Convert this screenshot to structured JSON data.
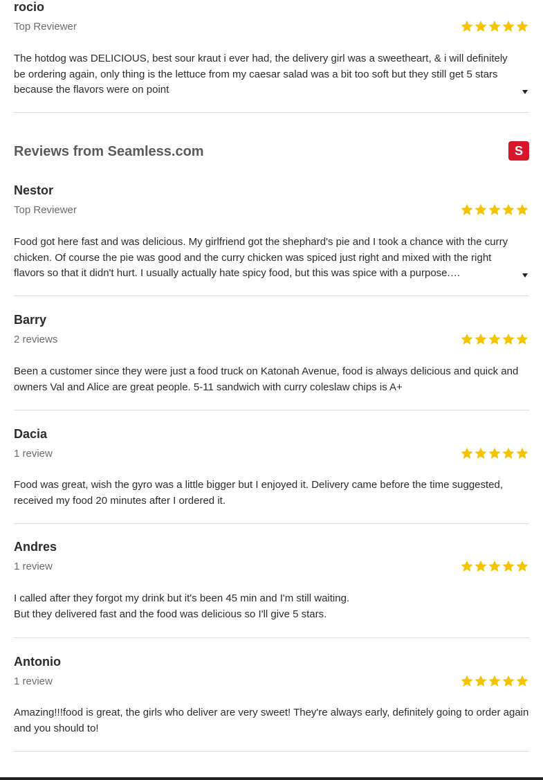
{
  "top_review": {
    "name": "rocio",
    "subtitle": "Top Reviewer",
    "rating": 5,
    "text": "The hotdog was DELICIOUS, best sour kraut i ever had, the delivery girl was a sweetheart, & i will definitely be ordering again, only thing is the lettuce from my caesar salad was a bit too soft but they still get 5 stars because the flavors were on point"
  },
  "seamless_section": {
    "title": "Reviews from Seamless.com",
    "logo_letter": "S",
    "logo_color": "#d7152b"
  },
  "reviews": [
    {
      "name": "Nestor",
      "subtitle": "Top Reviewer",
      "rating": 5,
      "text": "Food got here fast and was delicious. My girlfriend got the shephard's pie and I took a chance with the curry chicken. Of course the pie was good and the curry chicken was spiced just right and mixed with the right flavors so that it didn't hurt. I usually actually hate spicy food, but this was spice with a purpose. Generous…"
    },
    {
      "name": "Barry",
      "subtitle": "2 reviews",
      "rating": 5,
      "text": "Been a customer since they were just a food truck on Katonah Avenue, food is always delicious and quick and owners Val and Alice are great people. 5-11 sandwich with curry coleslaw chips is A+"
    },
    {
      "name": "Dacia",
      "subtitle": "1 review",
      "rating": 5,
      "text": "Food was great, wish the gyro was a little bigger but I enjoyed it. Delivery came before the time suggested, received my food 20 minutes after I ordered it."
    },
    {
      "name": "Andres",
      "subtitle": "1 review",
      "rating": 5,
      "text_line1": "I called after they forgot my drink but it's been 45 min and I'm still waiting.",
      "text_line2": "But they delivered fast and the food was delicious so I'll give 5 stars."
    },
    {
      "name": "Antonio",
      "subtitle": "1 review",
      "rating": 5,
      "text": "Amazing!!!food is great, the girls who deliver are very sweet! They're always early, definitely going to order again and you should to!"
    }
  ],
  "colors": {
    "star": "#f5c400",
    "divider": "#dcdcdc",
    "section_title": "#5a5a5a",
    "subtitle": "#6b6b6b"
  },
  "icons": {
    "star": "star-icon",
    "expand": "caret-down-icon",
    "logo": "seamless-logo-icon"
  }
}
